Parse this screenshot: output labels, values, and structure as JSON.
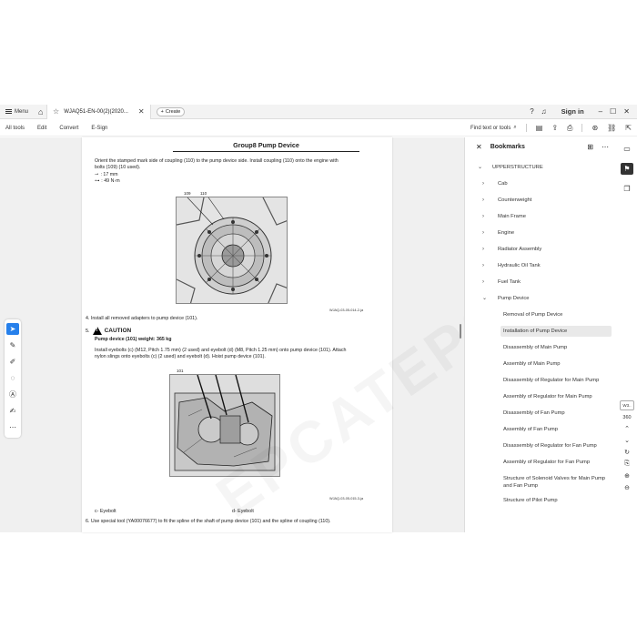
{
  "tabbar": {
    "menu_label": "Menu",
    "doc_tab_title": "WJAQ51-EN-00(2)(2020...",
    "create_label": "Create",
    "signin_label": "Sign in"
  },
  "toolbar": {
    "items": [
      "All tools",
      "Edit",
      "Convert",
      "E-Sign"
    ],
    "find_label": "Find text or tools"
  },
  "page": {
    "title": "Group8 Pump Device",
    "para1_line1": "Orient the stamped mark side of coupling (110) to the pump device side. Install coupling (110) onto the engine with",
    "para1_line2": "bolts (109) (10 used).",
    "wrench_value": ": 17 mm",
    "torque_value": ": 49 N·m",
    "fig1_label1": "109",
    "fig1_label2": "110",
    "fig1_code": "WJAQ-03-05-014-2-ja",
    "step4": "4.   Install all removed adapters to pump device (101).",
    "step5_num": "5.",
    "caution_label": "CAUTION",
    "caution_text": "Pump device (101) weight: 365 kg",
    "para2_line1": "Install eyebolts (c) (M12, Pitch 1.75 mm) (2 used) and eyebolt (d) (M8, Pitch 1.25 mm) onto pump device (101). Attach",
    "para2_line2": "nylon slings onto eyebolts (c) (2 used) and eyebolt (d). Hoist pump device (101).",
    "fig2_label": "101",
    "fig2_code": "WJAQ-03-05-015-3-ja",
    "caption_c": "c-  Eyebolt",
    "caption_d": "d-  Eyebolt",
    "step6": "6.   Use special tool (YA00076677) to fit the spline of the shaft of pump device (101) and the spline of coupling (110).",
    "watermark": "EPCATEPO.CO"
  },
  "bookmarks": {
    "header": "Bookmarks",
    "items": [
      {
        "label": "UPPERSTRUCTURE",
        "chevron": "⌄"
      },
      {
        "label": "Cab",
        "chevron": "›"
      },
      {
        "label": "Counterweight",
        "chevron": "›"
      },
      {
        "label": "Main Frame",
        "chevron": "›"
      },
      {
        "label": "Engine",
        "chevron": "›"
      },
      {
        "label": "Radiator Assembly",
        "chevron": "›"
      },
      {
        "label": "Hydraulic Oil Tank",
        "chevron": "›"
      },
      {
        "label": "Fuel Tank",
        "chevron": "›"
      },
      {
        "label": "Pump Device",
        "chevron": "⌄"
      },
      {
        "label": "Removal of Pump Device"
      },
      {
        "label": "Installation of Pump Device"
      },
      {
        "label": "Disassembly of Main Pump"
      },
      {
        "label": "Assembly of Main Pump"
      },
      {
        "label": "Disassembly of Regulator for Main Pump"
      },
      {
        "label": "Assembly of Regulator for Main Pump"
      },
      {
        "label": "Disassembly of Fan Pump"
      },
      {
        "label": "Assembly of Fan Pump"
      },
      {
        "label": "Disassembly of Regulator for Fan Pump"
      },
      {
        "label": "Assembly of Regulator for Fan Pump"
      },
      {
        "label": "Structure of Solenoid Valves for Main Pump and Fan Pump"
      },
      {
        "label": "Structure of Pilot Pump"
      }
    ]
  },
  "rail": {
    "page_box": "W3..",
    "page_count": "360"
  }
}
